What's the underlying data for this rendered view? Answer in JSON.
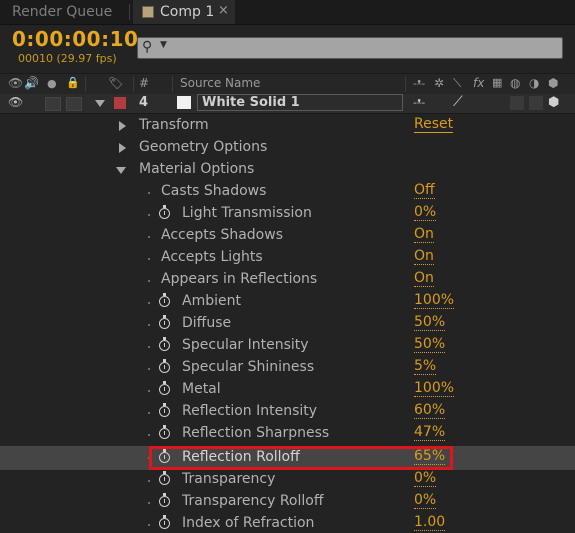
{
  "tabs": {
    "render_queue": "Render Queue",
    "comp": "Comp 1",
    "close_glyph": "×"
  },
  "header": {
    "timecode": "0:00:00:10",
    "fps": "00010 (29.97 fps)",
    "search_placeholder": ""
  },
  "columns": {
    "num": "#",
    "source_name": "Source Name",
    "switch_icons": "-꠸- ✲ \\ fx"
  },
  "layer": {
    "number": "4",
    "name": "White Solid 1",
    "label_color": "#b43c3c"
  },
  "groups": [
    {
      "name": "Transform",
      "value": "Reset"
    },
    {
      "name": "Geometry Options"
    },
    {
      "name": "Material Options"
    }
  ],
  "properties": [
    {
      "name": "Casts Shadows",
      "value": "Off",
      "stopwatch": false
    },
    {
      "name": "Light Transmission",
      "value": "0%",
      "stopwatch": true
    },
    {
      "name": "Accepts Shadows",
      "value": "On",
      "stopwatch": false
    },
    {
      "name": "Accepts Lights",
      "value": "On",
      "stopwatch": false
    },
    {
      "name": "Appears in Reflections",
      "value": "On",
      "stopwatch": false
    },
    {
      "name": "Ambient",
      "value": "100%",
      "stopwatch": true
    },
    {
      "name": "Diffuse",
      "value": "50%",
      "stopwatch": true
    },
    {
      "name": "Specular Intensity",
      "value": "50%",
      "stopwatch": true
    },
    {
      "name": "Specular Shininess",
      "value": "5%",
      "stopwatch": true
    },
    {
      "name": "Metal",
      "value": "100%",
      "stopwatch": true
    },
    {
      "name": "Reflection Intensity",
      "value": "60%",
      "stopwatch": true
    },
    {
      "name": "Reflection Sharpness",
      "value": "47%",
      "stopwatch": true
    },
    {
      "name": "Reflection Rolloff",
      "value": "65%",
      "stopwatch": true,
      "highlighted": true
    },
    {
      "name": "Transparency",
      "value": "0%",
      "stopwatch": true
    },
    {
      "name": "Transparency Rolloff",
      "value": "0%",
      "stopwatch": true
    },
    {
      "name": "Index of Refraction",
      "value": "1.00",
      "stopwatch": true
    }
  ],
  "colors": {
    "accent_orange": "#d89c1f",
    "timecode": "#e6a820",
    "highlight_border": "#e0141b"
  }
}
